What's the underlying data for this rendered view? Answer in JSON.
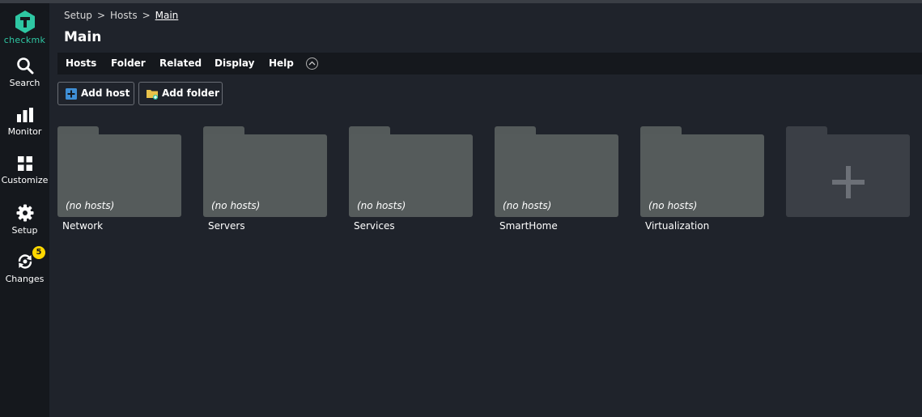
{
  "app": {
    "logo_text": "checkmk",
    "brand_color": "#2ec7a3",
    "badge_color": "#ffd800"
  },
  "sidebar": {
    "items": [
      {
        "label": "Search",
        "icon": "search-icon"
      },
      {
        "label": "Monitor",
        "icon": "bar-chart-icon"
      },
      {
        "label": "Customize",
        "icon": "grid-icon"
      },
      {
        "label": "Setup",
        "icon": "gear-icon"
      },
      {
        "label": "Changes",
        "icon": "changes-icon",
        "badge": "5"
      }
    ]
  },
  "breadcrumb": {
    "items": [
      "Setup",
      "Hosts"
    ],
    "current": "Main",
    "separator": ">"
  },
  "page": {
    "title": "Main"
  },
  "menubar": {
    "items": [
      "Hosts",
      "Folder",
      "Related",
      "Display",
      "Help"
    ]
  },
  "toolbar": {
    "add_host": "Add host",
    "add_folder": "Add folder"
  },
  "folders": [
    {
      "name": "Network",
      "hosts": "(no hosts)"
    },
    {
      "name": "Servers",
      "hosts": "(no hosts)"
    },
    {
      "name": "Services",
      "hosts": "(no hosts)"
    },
    {
      "name": "SmartHome",
      "hosts": "(no hosts)"
    },
    {
      "name": "Virtualization",
      "hosts": "(no hosts)"
    }
  ],
  "new_folder": {
    "icon": "plus-icon"
  }
}
